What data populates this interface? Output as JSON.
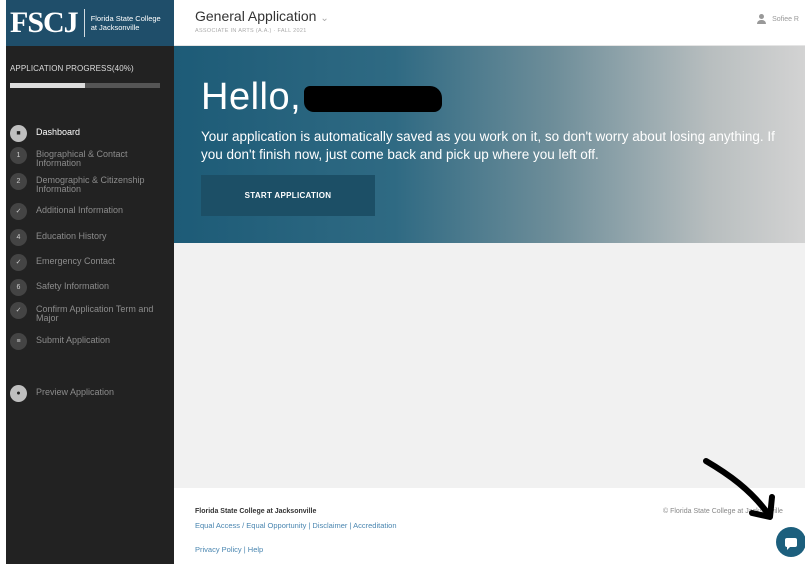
{
  "logo": {
    "mark": "FSCJ",
    "line1": "Florida State College",
    "line2": "at Jacksonville"
  },
  "progress": {
    "title": "APPLICATION PROGRESS(40%)",
    "value": 0.5
  },
  "nav": [
    {
      "num": "■",
      "label": "Dashboard"
    },
    {
      "num": "1",
      "label": "Biographical & Contact Information"
    },
    {
      "num": "2",
      "label": "Demographic & Citizenship Information"
    },
    {
      "num": "✓",
      "label": "Additional Information"
    },
    {
      "num": "4",
      "label": "Education History"
    },
    {
      "num": "✓",
      "label": "Emergency Contact"
    },
    {
      "num": "6",
      "label": "Safety Information"
    },
    {
      "num": "✓",
      "label": "Confirm Application Term and Major"
    },
    {
      "num": "≡",
      "label": "Submit Application"
    },
    {
      "num": "●",
      "label": "Preview Application"
    }
  ],
  "header": {
    "title": "General Application",
    "subtitle": "ASSOCIATE IN ARTS (A.A.) · FALL 2021",
    "user": "Sofiee R"
  },
  "hero": {
    "greeting": "Hello,",
    "message": "Your application is automatically saved as you work on it, so don't worry about losing anything. If you don't finish now, just come back and pick up where you left off.",
    "button": "START APPLICATION"
  },
  "footer": {
    "college": "Florida State College at Jacksonville",
    "links1": "Equal Access / Equal Opportunity | Disclaimer | Accreditation",
    "links2": "Privacy Policy  |  Help",
    "copyright": "© Florida State College at Jacksonville"
  },
  "colors": {
    "sidebar": "#222222",
    "brand": "#1f4e6a",
    "button": "#1c4f66",
    "link": "#4a86b0"
  }
}
